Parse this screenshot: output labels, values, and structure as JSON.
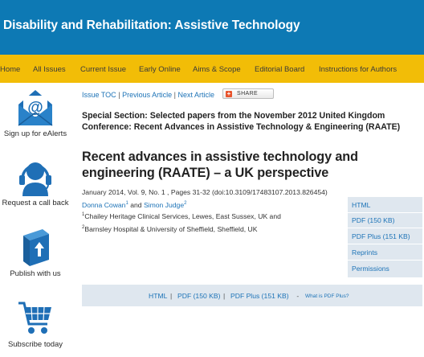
{
  "header": {
    "title": "Disability and Rehabilitation: Assistive Technology"
  },
  "nav": {
    "items": [
      "Home",
      "All Issues",
      "Current Issue",
      "Early Online",
      "Aims & Scope",
      "Editorial Board",
      "Instructions for Authors"
    ]
  },
  "sidebar": {
    "items": [
      {
        "label": "Sign up for eAlerts",
        "icon": "envelope-at-icon"
      },
      {
        "label": "Request a call back",
        "icon": "headset-icon"
      },
      {
        "label": "Publish with us",
        "icon": "book-upload-icon"
      },
      {
        "label": "Subscribe today",
        "icon": "shopping-cart-icon"
      }
    ]
  },
  "breadcrumb": {
    "issue_toc": "Issue TOC",
    "prev": "Previous Article",
    "next": "Next Article",
    "sep": "|"
  },
  "share": {
    "label": "SHARE",
    "plus": "+"
  },
  "article": {
    "section": "Special Section: Selected papers from the November 2012 United Kingdom Conference: Recent Advances in Assistive Technology & Engineering (RAATE)",
    "title": "Recent advances in assistive technology and engineering (RAATE) – a UK perspective",
    "citation": "January 2014, Vol. 9, No. 1 , Pages 31-32 (doi:10.3109/17483107.2013.826454)",
    "authors": [
      {
        "name": "Donna Cowan",
        "sup": "1"
      },
      {
        "name": "Simon Judge",
        "sup": "2"
      }
    ],
    "author_join": "and",
    "affiliations": [
      {
        "sup": "1",
        "text": "Chailey Heritage Clinical Services, Lewes, East Sussex, UK and"
      },
      {
        "sup": "2",
        "text": "Barnsley Hospital & University of Sheffield, Sheffield, UK"
      }
    ]
  },
  "formats": {
    "items": [
      "HTML",
      "PDF (150 KB)",
      "PDF Plus (151 KB)",
      "Reprints",
      "Permissions"
    ]
  },
  "bottom": {
    "html": "HTML",
    "pdf": "PDF (150 KB)",
    "pdfplus": "PDF Plus (151 KB)",
    "dash": " - ",
    "what": "What is PDF Plus?",
    "sep": "|"
  },
  "colors": {
    "header": "#0d79b4",
    "nav": "#f2bd07",
    "link": "#1d73b7",
    "panel": "#dfe7ef"
  }
}
